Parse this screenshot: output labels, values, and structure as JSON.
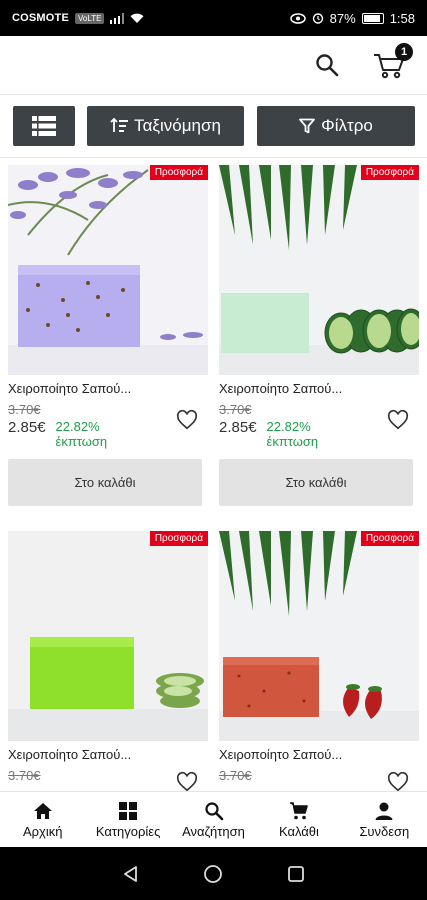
{
  "status_bar": {
    "carrier": "COSMOTE",
    "network_badge": "VoLTE",
    "battery": "87%",
    "time": "1:58"
  },
  "header": {
    "cart_count": "1",
    "icons": [
      "search-icon",
      "cart-icon"
    ]
  },
  "toolbar": {
    "sort_label": "Ταξινόμηση",
    "filter_label": "Φίλτρο"
  },
  "products": [
    {
      "badge": "Προσφορά",
      "title": "Χειροποίητο Σαπού...",
      "old_price": "3.70€",
      "price": "2.85€",
      "discount_pct": "22.82%",
      "discount_label": "έκπτωση",
      "button": "Στο καλάθι",
      "image": "lavender-soap"
    },
    {
      "badge": "Προσφορά",
      "title": "Χειροποίητο Σαπού...",
      "old_price": "3.70€",
      "price": "2.85€",
      "discount_pct": "22.82%",
      "discount_label": "έκπτωση",
      "button": "Στο καλάθι",
      "image": "cucumber-soap"
    },
    {
      "badge": "Προσφορά",
      "title": "Χειροποίητο Σαπού...",
      "old_price": "3.70€",
      "image": "aloe-soap"
    },
    {
      "badge": "Προσφορά",
      "title": "Χειροποίητο Σαπού...",
      "old_price": "3.70€",
      "image": "strawberry-soap"
    }
  ],
  "bottom_nav": [
    {
      "label": "Αρχική",
      "icon": "home-icon"
    },
    {
      "label": "Κατηγορίες",
      "icon": "grid-icon"
    },
    {
      "label": "Αναζήτηση",
      "icon": "search-icon"
    },
    {
      "label": "Καλάθι",
      "icon": "cart-icon"
    },
    {
      "label": "Συνδεση",
      "icon": "person-icon"
    }
  ],
  "colors": {
    "toolbar_button": "#3d4247",
    "promo_badge": "#e2001a",
    "discount_text": "#1e9e4a",
    "add_button": "#e3e3e3"
  }
}
